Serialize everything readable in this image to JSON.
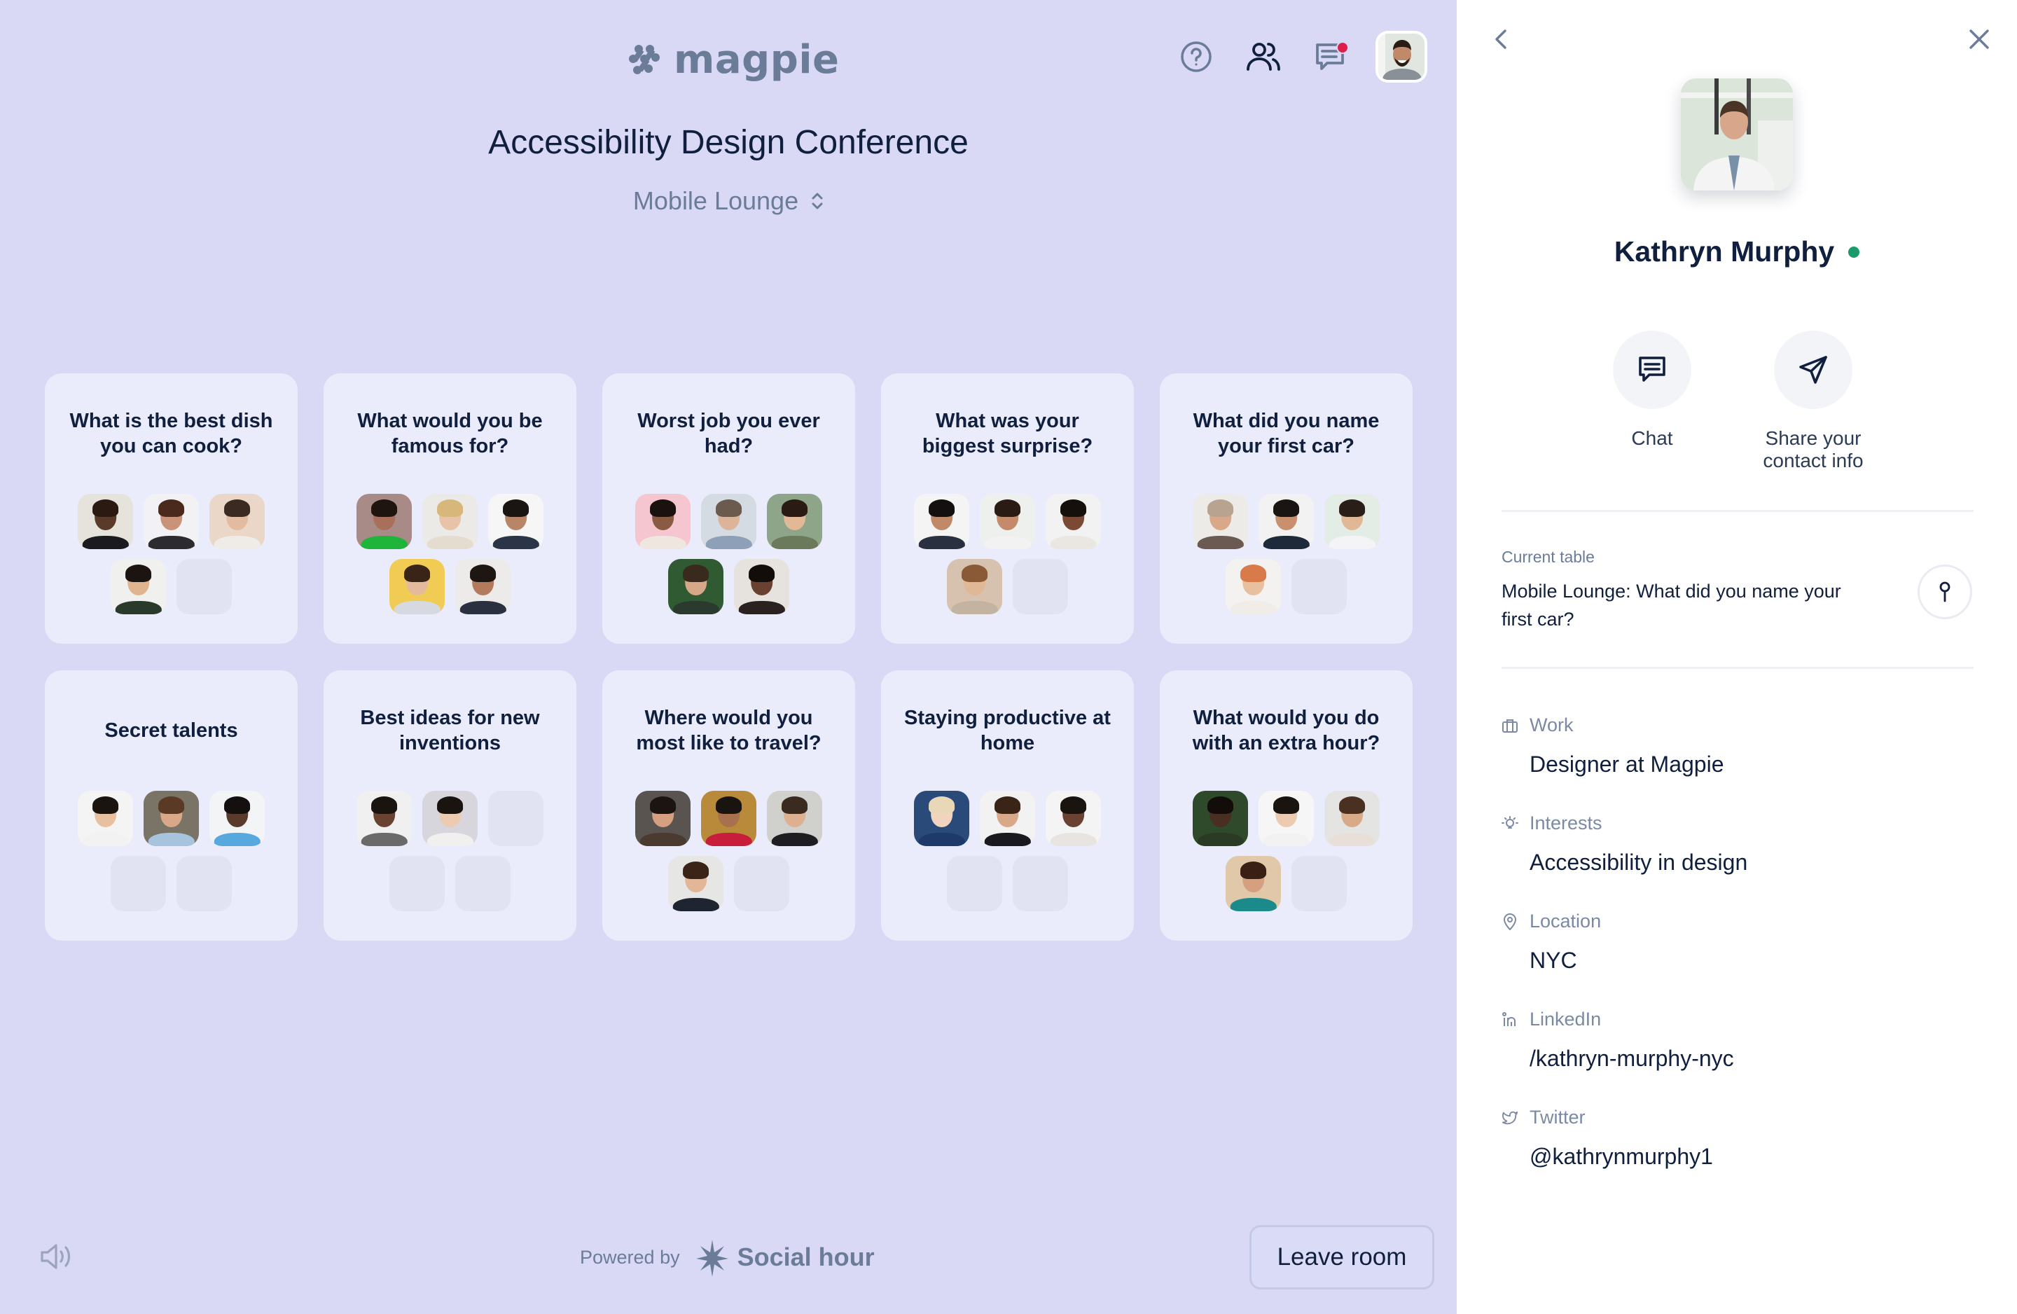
{
  "app": {
    "logo_text": "magpie",
    "event_title": "Accessibility Design Conference",
    "room": "Mobile Lounge",
    "header_icons": [
      "help-icon",
      "people-icon",
      "chat-notifications-icon",
      "my-avatar"
    ],
    "notification_color": "#dc1f4b"
  },
  "tables": [
    {
      "title": "What is the best dish you can cook?",
      "seats": [
        {
          "skin": "#5a3a28",
          "hair": "#2a1a12",
          "shirt": "#1b1b1f",
          "bg": "#e6e2dc"
        },
        {
          "skin": "#c99379",
          "hair": "#4a2a1d",
          "shirt": "#2b2b30",
          "bg": "#f2f2f4"
        },
        {
          "skin": "#e3bba0",
          "hair": "#3a2a22",
          "shirt": "#efece8",
          "bg": "#ead7c8"
        },
        {
          "skin": "#e0b48e",
          "hair": "#1c1410",
          "shirt": "#2a3a2a",
          "bg": "#f0f0ef"
        },
        null
      ]
    },
    {
      "title": "What would you be famous for?",
      "seats": [
        {
          "skin": "#a8705a",
          "hair": "#1f1510",
          "shirt": "#1fb53a",
          "bg": "#a88a86"
        },
        {
          "skin": "#e8c3a8",
          "hair": "#d8b77a",
          "shirt": "#e5dcd0",
          "bg": "#eceae6"
        },
        {
          "skin": "#b88566",
          "hair": "#1a1412",
          "shirt": "#2c3548",
          "bg": "#f6f6f6"
        },
        {
          "skin": "#e4b99c",
          "hair": "#3a2418",
          "shirt": "#d6dae0",
          "bg": "#f1cc55"
        },
        {
          "skin": "#b47a5c",
          "hair": "#1e1612",
          "shirt": "#2a3040",
          "bg": "#ecebea"
        }
      ]
    },
    {
      "title": "Worst job you ever had?",
      "seats": [
        {
          "skin": "#8a5a42",
          "hair": "#1a120e",
          "shirt": "#f0e6e0",
          "bg": "#f5c6cf"
        },
        {
          "skin": "#dcb49a",
          "hair": "#6b5a4e",
          "shirt": "#8ea0b8",
          "bg": "#d4dbe2"
        },
        {
          "skin": "#e2b896",
          "hair": "#2a1c14",
          "shirt": "#6a7a5a",
          "bg": "#8fa58a"
        },
        {
          "skin": "#d6a888",
          "hair": "#3a2a1e",
          "shirt": "#2a3a2e",
          "bg": "#2f5a32"
        },
        {
          "skin": "#6a4030",
          "hair": "#120c0a",
          "shirt": "#2a2220",
          "bg": "#e6e2de"
        }
      ]
    },
    {
      "title": "What was your biggest surprise?",
      "seats": [
        {
          "skin": "#c08a68",
          "hair": "#141010",
          "shirt": "#2a3040",
          "bg": "#f4f4f4"
        },
        {
          "skin": "#c48a6a",
          "hair": "#2a1c14",
          "shirt": "#f2f2f2",
          "bg": "#eef0ee"
        },
        {
          "skin": "#7a4a34",
          "hair": "#16100c",
          "shirt": "#eae6e2",
          "bg": "#f2f2f2"
        },
        {
          "skin": "#e0b896",
          "hair": "#8a5a36",
          "shirt": "#c2b4a0",
          "bg": "#d6c2ae"
        },
        null
      ]
    },
    {
      "title": "What did you name your first car?",
      "seats": [
        {
          "skin": "#d8a888",
          "hair": "#b8a290",
          "shirt": "#6a5a52",
          "bg": "#ecebe8"
        },
        {
          "skin": "#c8906e",
          "hair": "#1a1412",
          "shirt": "#1e2a3a",
          "bg": "#f2f2f2"
        },
        {
          "skin": "#e0b896",
          "hair": "#2a1e18",
          "shirt": "#f4f4f6",
          "bg": "#e4ece6"
        },
        {
          "skin": "#e8c0a0",
          "hair": "#d87a4a",
          "shirt": "#f0ece8",
          "bg": "#f4f2f0"
        },
        null
      ]
    },
    {
      "title": "Secret talents",
      "seats": [
        {
          "skin": "#e8c0a0",
          "hair": "#1a1410",
          "shirt": "#f2f2f2",
          "bg": "#f4f4f4"
        },
        {
          "skin": "#d8a888",
          "hair": "#5a3a24",
          "shirt": "#a8c4dc",
          "bg": "#7a7466"
        },
        {
          "skin": "#5a3a2a",
          "hair": "#141010",
          "shirt": "#58a8e0",
          "bg": "#f2f4f6"
        },
        null,
        null
      ]
    },
    {
      "title": "Best ideas for new inventions",
      "seats": [
        {
          "skin": "#6a4232",
          "hair": "#1a1410",
          "shirt": "#6a6a6a",
          "bg": "#f0f0f0"
        },
        {
          "skin": "#eccbb0",
          "hair": "#1a1410",
          "shirt": "#f2f0ee",
          "bg": "#d6d6dc"
        },
        null,
        null,
        null
      ]
    },
    {
      "title": "Where would you most like to travel?",
      "seats": [
        {
          "skin": "#d4a080",
          "hair": "#1c1410",
          "shirt": "#4a3a30",
          "bg": "#5a5450"
        },
        {
          "skin": "#a8704e",
          "hair": "#1a1410",
          "shirt": "#c81e3c",
          "bg": "#b88a3a"
        },
        {
          "skin": "#dcb090",
          "hair": "#3a2a20",
          "shirt": "#1e1e22",
          "bg": "#d0d0cc"
        },
        {
          "skin": "#e2b696",
          "hair": "#3a2418",
          "shirt": "#1e2430",
          "bg": "#e6e6e4"
        },
        null
      ]
    },
    {
      "title": "Staying productive at home",
      "seats": [
        {
          "skin": "#f0d4be",
          "hair": "#e8d8b8",
          "shirt": "#1e3a6a",
          "bg": "#2a4a7a"
        },
        {
          "skin": "#d8a888",
          "hair": "#3a2418",
          "shirt": "#1a1a1e",
          "bg": "#f2f2f2"
        },
        {
          "skin": "#6a4232",
          "hair": "#1a1410",
          "shirt": "#e8e4e0",
          "bg": "#f4f4f4"
        },
        null,
        null
      ]
    },
    {
      "title": "What would you do with an extra hour?",
      "seats": [
        {
          "skin": "#4a2e22",
          "hair": "#120c0a",
          "shirt": "#2a3a24",
          "bg": "#2e4a2a"
        },
        {
          "skin": "#eccbb0",
          "hair": "#1a1410",
          "shirt": "#f2f2f2",
          "bg": "#f6f6f6"
        },
        {
          "skin": "#d8aa88",
          "hair": "#4a3020",
          "shirt": "#e8e0d8",
          "bg": "#e4e4e2"
        },
        {
          "skin": "#d4a080",
          "hair": "#3a2014",
          "shirt": "#1a8a8a",
          "bg": "#e0c8a8"
        },
        null
      ]
    }
  ],
  "footer": {
    "powered_by": "Powered by",
    "brand": "Social hour",
    "leave_button": "Leave room"
  },
  "profile": {
    "name": "Kathryn Murphy",
    "status": "online",
    "status_color": "#1b9a6b",
    "actions": [
      {
        "label": "Chat",
        "icon": "chat-icon"
      },
      {
        "label": "Share your contact info",
        "icon": "send-icon"
      }
    ],
    "current_table_label": "Current table",
    "current_table_value": "Mobile Lounge: What did you name your first car?",
    "fields": [
      {
        "label": "Work",
        "value": "Designer at Magpie",
        "icon": "briefcase-icon"
      },
      {
        "label": "Interests",
        "value": "Accessibility in design",
        "icon": "lightbulb-icon"
      },
      {
        "label": "Location",
        "value": "NYC",
        "icon": "location-pin-icon"
      },
      {
        "label": "LinkedIn",
        "value": "/kathryn-murphy-nyc",
        "icon": "linkedin-icon"
      },
      {
        "label": "Twitter",
        "value": "@kathrynmurphy1",
        "icon": "twitter-icon"
      }
    ]
  }
}
